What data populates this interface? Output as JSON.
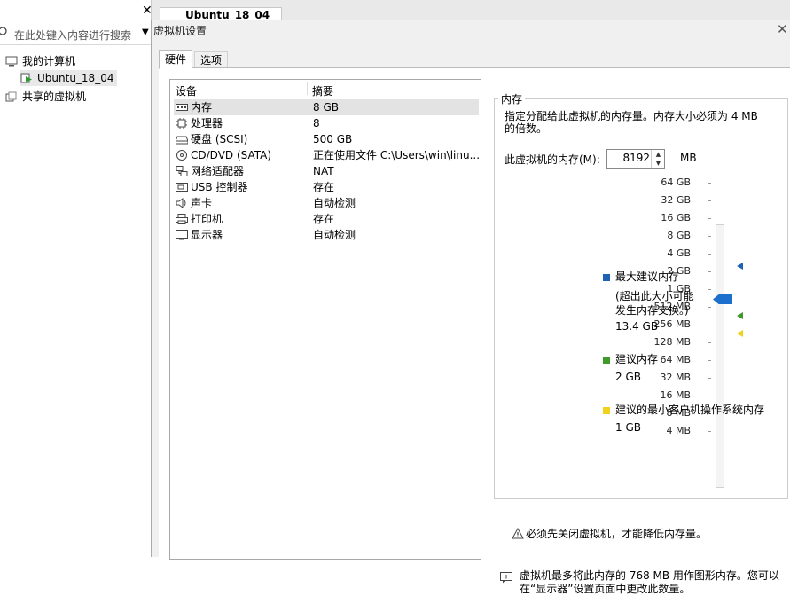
{
  "library": {
    "search_placeholder": "在此处键入内容进行搜索",
    "tree": {
      "my_computer": "我的计算机",
      "vm": "Ubuntu_18_04",
      "shared": "共享的虚拟机"
    }
  },
  "tab": {
    "title": "Ubuntu_18_04"
  },
  "dialog": {
    "title": "虚拟机设置",
    "tabs": [
      "硬件",
      "选项"
    ],
    "columns": [
      "设备",
      "摘要"
    ],
    "devices": [
      {
        "name": "内存",
        "summary": "8 GB",
        "icon": "memory-icon"
      },
      {
        "name": "处理器",
        "summary": "8",
        "icon": "cpu-icon"
      },
      {
        "name": "硬盘 (SCSI)",
        "summary": "500 GB",
        "icon": "harddisk-icon"
      },
      {
        "name": "CD/DVD (SATA)",
        "summary": "正在使用文件 C:\\Users\\win\\linu...",
        "icon": "cdrom-icon"
      },
      {
        "name": "网络适配器",
        "summary": "NAT",
        "icon": "network-icon"
      },
      {
        "name": "USB 控制器",
        "summary": "存在",
        "icon": "usb-icon"
      },
      {
        "name": "声卡",
        "summary": "自动检测",
        "icon": "sound-icon"
      },
      {
        "name": "打印机",
        "summary": "存在",
        "icon": "printer-icon"
      },
      {
        "name": "显示器",
        "summary": "自动检测",
        "icon": "display-icon"
      }
    ],
    "memory": {
      "legend": "内存",
      "description": "指定分配给此虚拟机的内存量。内存大小必须为 4 MB 的倍数。",
      "field_label": "此虚拟机的内存(M):",
      "value": "8192",
      "unit": "MB",
      "scale": [
        "64 GB",
        "32 GB",
        "16 GB",
        "8 GB",
        "4 GB",
        "2 GB",
        "1 GB",
        "512 MB",
        "256 MB",
        "128 MB",
        "64 MB",
        "32 MB",
        "16 MB",
        "8 MB",
        "4 MB"
      ],
      "legend_items": [
        {
          "title": "最大建议内存",
          "note1": "(超出此大小可能",
          "note2": "发生内存交换。)",
          "value": "13.4 GB",
          "color": "#1e62b4"
        },
        {
          "title": "建议内存",
          "value": "2 GB",
          "color": "#3f9a2a"
        },
        {
          "title": "建议的最小客户机操作系统内存",
          "value": "1 GB",
          "color": "#f0d21c"
        }
      ],
      "warning": "必须先关闭虚拟机，才能降低内存量。",
      "info_line1": "虚拟机最多将此内存的 768 MB 用作图形内存。您可以",
      "info_line2": "在“显示器”设置页面中更改此数量。"
    }
  }
}
